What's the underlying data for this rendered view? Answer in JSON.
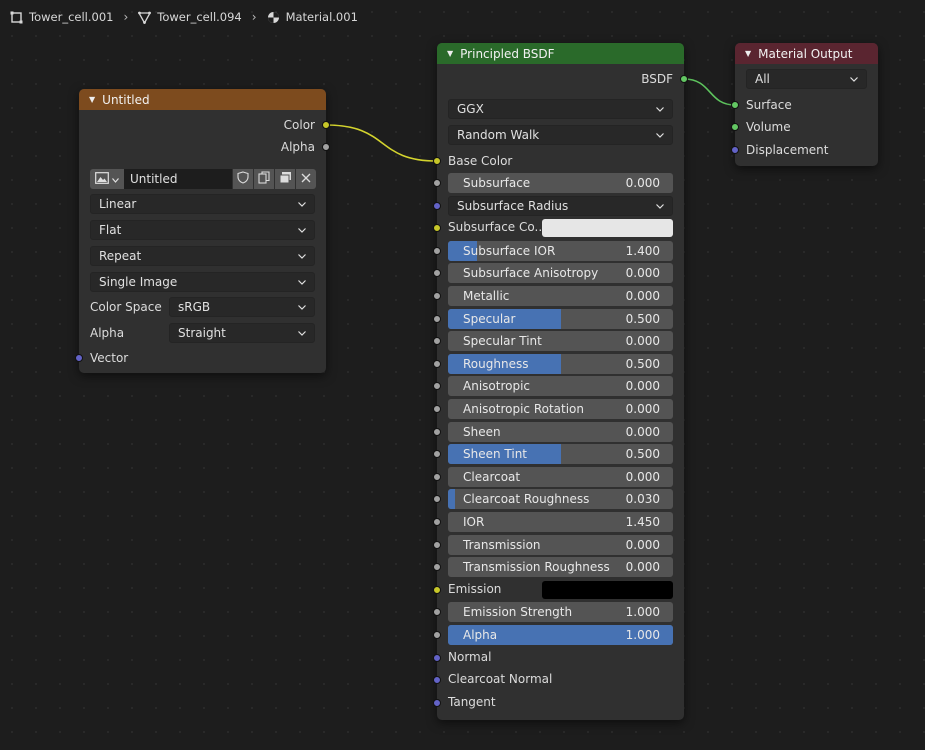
{
  "breadcrumb": {
    "object": "Tower_cell.001",
    "mesh": "Tower_cell.094",
    "material": "Material.001"
  },
  "image_node": {
    "title": "Untitled",
    "outputs": {
      "color": "Color",
      "alpha": "Alpha"
    },
    "image_name": "Untitled",
    "interpolation": "Linear",
    "projection": "Flat",
    "extension": "Repeat",
    "source": "Single Image",
    "color_space_label": "Color Space",
    "color_space": "sRGB",
    "alpha_label": "Alpha",
    "alpha_mode": "Straight",
    "vector_input": "Vector",
    "header_color": "#7d4b1e"
  },
  "bsdf": {
    "title": "Principled BSDF",
    "output": "BSDF",
    "distribution": "GGX",
    "subsurface_method": "Random Walk",
    "base_color_label": "Base Color",
    "subsurface_radius": "Subsurface Radius",
    "subsurface_color_label": "Subsurface Co...",
    "emission_label": "Emission",
    "normal_label": "Normal",
    "clearcoat_normal_label": "Clearcoat Normal",
    "tangent_label": "Tangent",
    "header_color": "#2a6a2a",
    "sliders": [
      {
        "label": "Subsurface",
        "value": "0.000",
        "fill": 0
      },
      {
        "label": "Subsurface IOR",
        "value": "1.400",
        "fill": 0.13
      },
      {
        "label": "Subsurface Anisotropy",
        "value": "0.000",
        "fill": 0
      },
      {
        "label": "Metallic",
        "value": "0.000",
        "fill": 0
      },
      {
        "label": "Specular",
        "value": "0.500",
        "fill": 0.5
      },
      {
        "label": "Specular Tint",
        "value": "0.000",
        "fill": 0
      },
      {
        "label": "Roughness",
        "value": "0.500",
        "fill": 0.5
      },
      {
        "label": "Anisotropic",
        "value": "0.000",
        "fill": 0
      },
      {
        "label": "Anisotropic Rotation",
        "value": "0.000",
        "fill": 0
      },
      {
        "label": "Sheen",
        "value": "0.000",
        "fill": 0
      },
      {
        "label": "Sheen Tint",
        "value": "0.500",
        "fill": 0.5
      },
      {
        "label": "Clearcoat",
        "value": "0.000",
        "fill": 0
      },
      {
        "label": "Clearcoat Roughness",
        "value": "0.030",
        "fill": 0.03
      },
      {
        "label": "IOR",
        "value": "1.450",
        "fill": 0
      },
      {
        "label": "Transmission",
        "value": "0.000",
        "fill": 0
      },
      {
        "label": "Transmission Roughness",
        "value": "0.000",
        "fill": 0
      },
      {
        "label": "Emission Strength",
        "value": "1.000",
        "fill": 0
      },
      {
        "label": "Alpha",
        "value": "1.000",
        "fill": 1
      }
    ]
  },
  "output_node": {
    "title": "Material Output",
    "target": "All",
    "surface": "Surface",
    "volume": "Volume",
    "displacement": "Displacement",
    "header_color": "#5a2530"
  },
  "colors": {
    "socket_color": "#c7c729",
    "socket_float": "#a1a1a1",
    "socket_vector": "#6363c7",
    "socket_shader": "#63c763",
    "slider_fill": "#4772b3",
    "subsurface_color": "#e6e6e6",
    "emission_color": "#000000"
  }
}
